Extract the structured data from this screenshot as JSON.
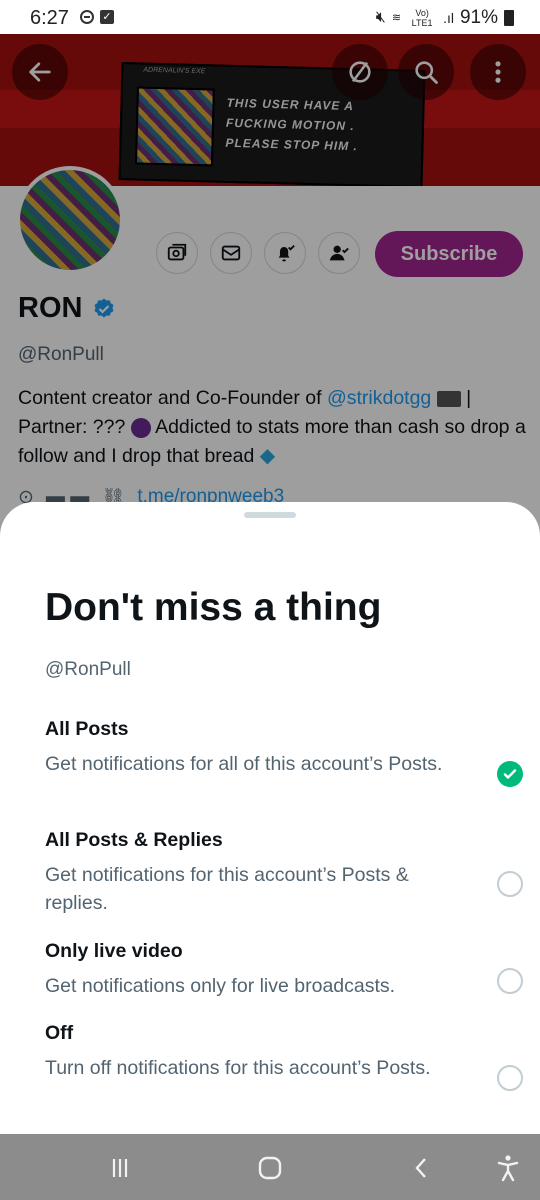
{
  "status_bar": {
    "time": "6:27",
    "battery": "91%",
    "signal_label": "Vo) LTE1"
  },
  "banner": {
    "card_small_text": "ADRENALIN'S EXE",
    "card_message": "THIS USER HAVE A FUCKING MOTION . PLEASE STOP HIM ."
  },
  "header_buttons": {
    "back_icon": "arrow-left-icon",
    "hide_icon": "circle-slash-icon",
    "search_icon": "search-icon",
    "more_icon": "more-vertical-icon"
  },
  "profile": {
    "name": "RON",
    "handle": "@RonPull",
    "subscribe_label": "Subscribe",
    "bio_part1": "Content creator and Co-Founder of ",
    "bio_mention": "@strikdotgg",
    "bio_part2": " | Partner: ??? ",
    "bio_part3": " Addicted to stats more than cash so drop a follow and I drop that bread ",
    "link_text": "t.me/ronpnweeb3"
  },
  "sheet": {
    "title": "Don't miss a thing",
    "handle": "@RonPull",
    "options": [
      {
        "title": "All Posts",
        "description": "Get notifications for all of this account’s Posts.",
        "selected": true
      },
      {
        "title": "All Posts & Replies",
        "description": "Get notifications for this account’s Posts & replies.",
        "selected": false
      },
      {
        "title": "Only live video",
        "description": "Get notifications only for live broadcasts.",
        "selected": false
      },
      {
        "title": "Off",
        "description": "Turn off notifications for this account’s Posts.",
        "selected": false
      }
    ]
  },
  "colors": {
    "accent_green": "#00ba7c",
    "subscribe_purple": "#a0248f",
    "link_blue": "#1d9bf0",
    "banner_red": "#a51010"
  }
}
